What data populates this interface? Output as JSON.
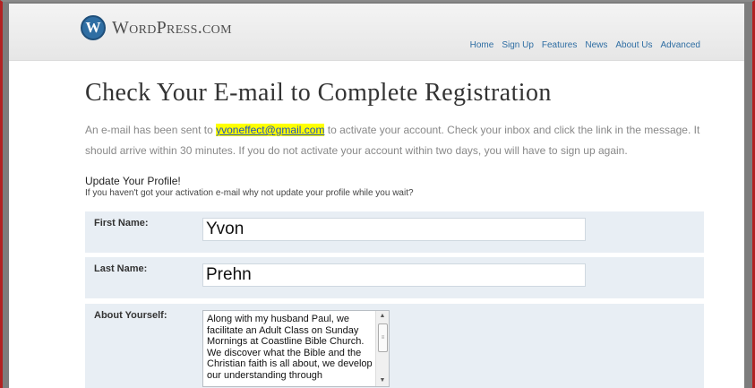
{
  "header": {
    "logo_text": "WordPress.com",
    "logo_mark": "W",
    "nav": [
      "Home",
      "Sign Up",
      "Features",
      "News",
      "About Us",
      "Advanced"
    ]
  },
  "main": {
    "title": "Check Your E-mail to Complete Registration",
    "intro_before": "An e-mail has been sent to ",
    "email": "yvoneffect@gmail.com",
    "intro_after": " to activate your account. Check your inbox and click the link in the message. It should arrive within 30 minutes. If you do not activate your account within two days, you will have to sign up again.",
    "update_title": "Update Your Profile!",
    "update_subtitle": "If you haven't got your activation e-mail why not update your profile while you wait?"
  },
  "form": {
    "first_name_label": "First Name:",
    "first_name_value": "Yvon",
    "last_name_label": "Last Name:",
    "last_name_value": "Prehn",
    "about_label": "About Yourself:",
    "about_value": "Along with my husband Paul, we facilitate an Adult Class on Sunday Mornings at Coastline Bible Church. We discover what the Bible and the Christian faith is all about, we develop our understanding through"
  },
  "icons": {
    "logo": "wordpress-logo-icon",
    "scroll_up": "scroll-up-arrow-icon",
    "scroll_down": "scroll-down-arrow-icon"
  }
}
